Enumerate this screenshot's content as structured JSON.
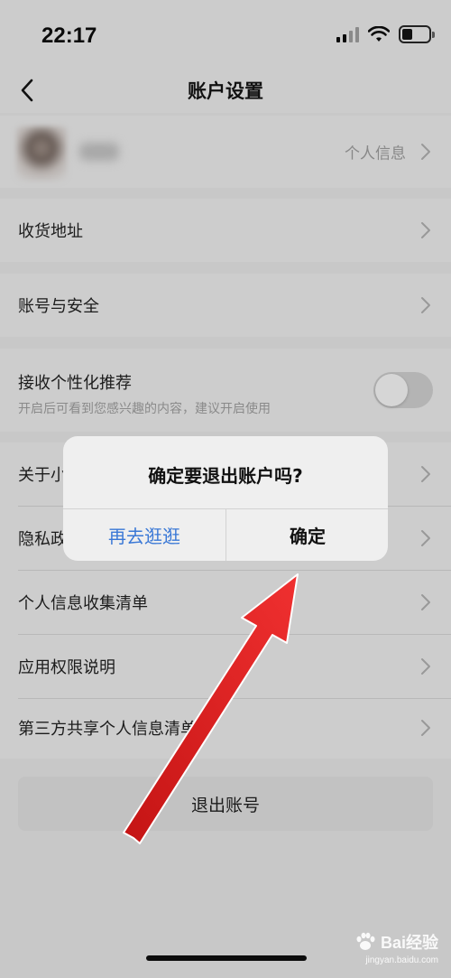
{
  "status_bar": {
    "time": "22:17"
  },
  "nav": {
    "title": "账户设置"
  },
  "profile": {
    "info_label": "个人信息"
  },
  "rows": {
    "address": "收货地址",
    "security": "账号与安全",
    "personalization": "接收个性化推荐",
    "personalization_desc": "开启后可看到您感兴趣的内容，建议开启使用",
    "about": "关于小",
    "privacy": "隐私政",
    "info_list": "个人信息收集清单",
    "permissions": "应用权限说明",
    "third_party": "第三方共享个人信息清单"
  },
  "toggle": {
    "personalization_on": false
  },
  "logout_button": "退出账号",
  "dialog": {
    "title": "确定要退出账户吗?",
    "cancel": "再去逛逛",
    "confirm": "确定"
  },
  "watermark": {
    "brand": "Bai经验",
    "url": "jingyan.baidu.com"
  },
  "colors": {
    "accent_blue": "#3a78d6",
    "arrow_red": "#e62020"
  }
}
